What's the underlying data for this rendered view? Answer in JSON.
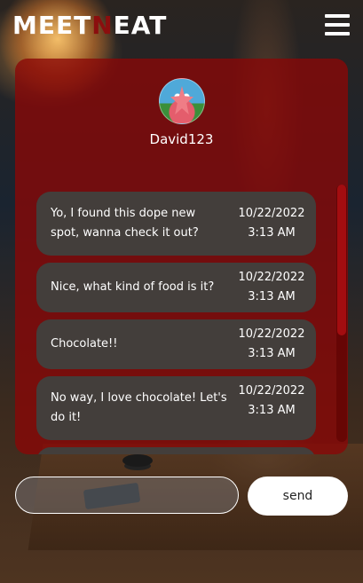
{
  "app": {
    "logo_part1": "MEET",
    "logo_part2": "N",
    "logo_part3": "EAT",
    "accent_color": "#8b0e0e"
  },
  "header": {
    "menu_icon": "hamburger-menu-icon"
  },
  "chat": {
    "username": "David123",
    "avatar_icon": "patrick-star-avatar",
    "messages": [
      {
        "text_line1": "Yo, I found this dope new",
        "text_line2": "spot, wanna check it out?",
        "date": "10/22/2022",
        "time": "3:13 AM"
      },
      {
        "text_line1": "Nice, what kind of food is it?",
        "text_line2": "",
        "date": "10/22/2022",
        "time": "3:13 AM"
      },
      {
        "text_line1": "Chocolate!!",
        "text_line2": "",
        "date": "10/22/2022",
        "time": "3:13 AM"
      },
      {
        "text_line1": "No way, I love chocolate! Let's",
        "text_line2": "do it!",
        "date": "10/22/2022",
        "time": "3:13 AM"
      }
    ]
  },
  "composer": {
    "input_value": "",
    "input_placeholder": "",
    "send_label": "send"
  }
}
